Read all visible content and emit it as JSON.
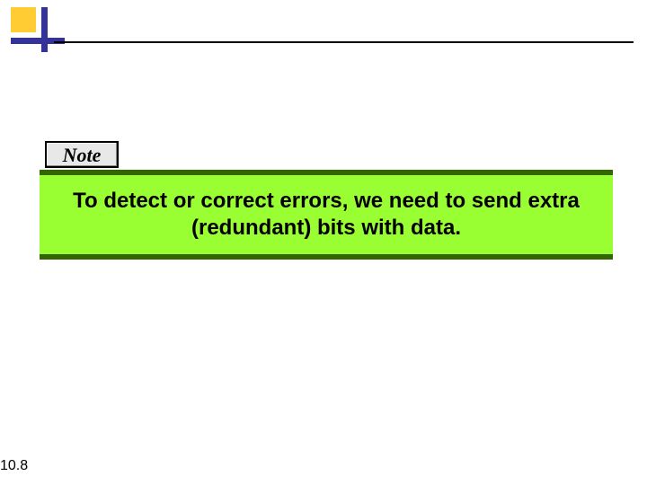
{
  "note": {
    "label": "Note",
    "body": "To detect or correct errors, we need to send extra (redundant) bits with data."
  },
  "page_number": "10.8"
}
